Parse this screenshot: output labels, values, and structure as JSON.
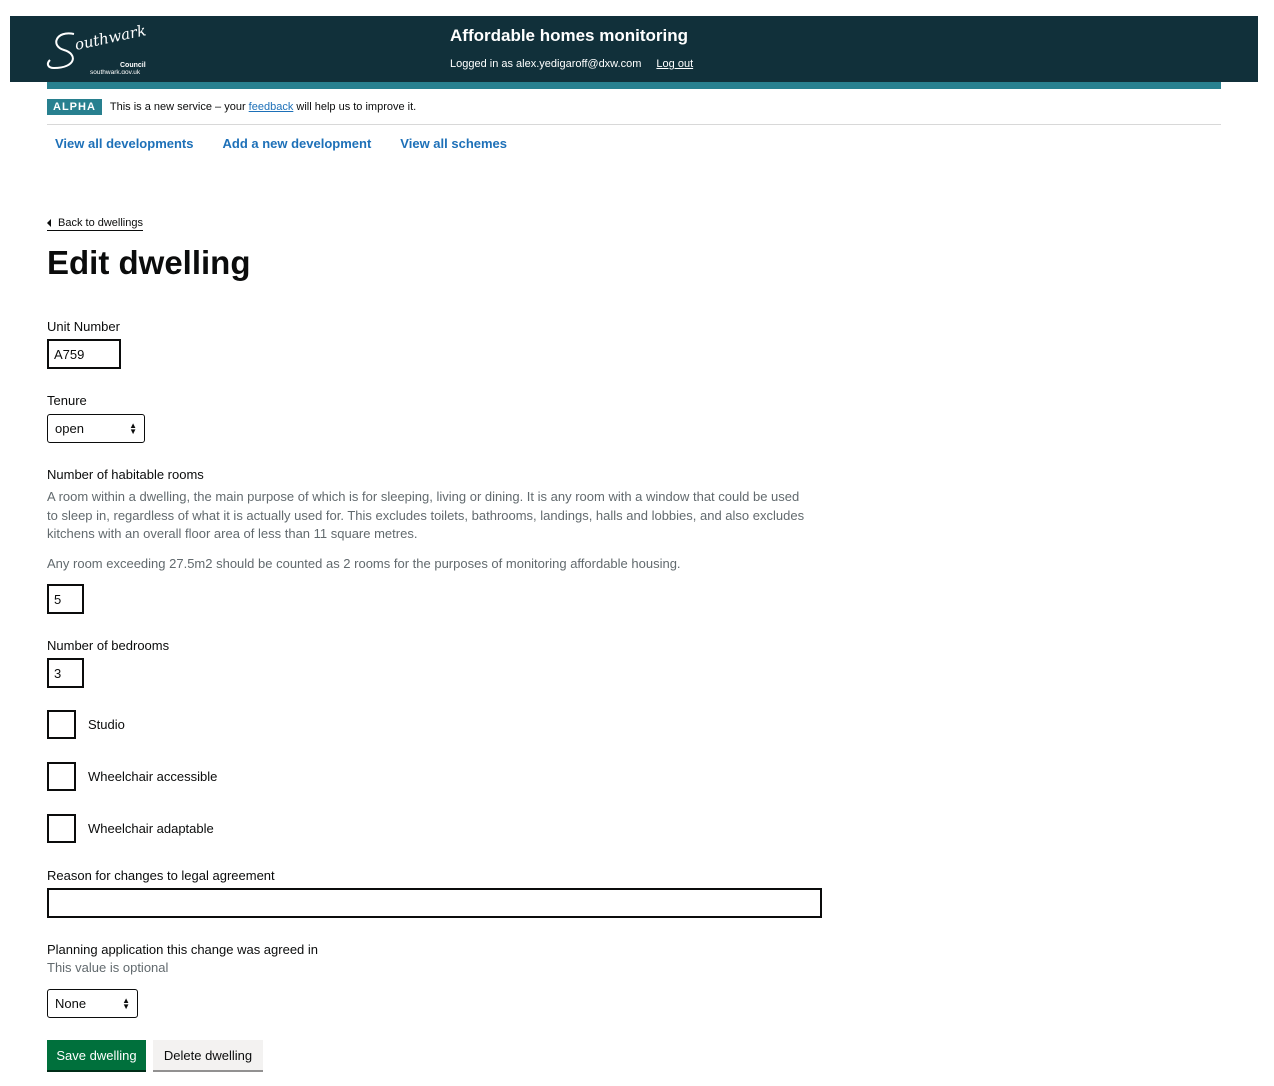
{
  "header": {
    "logo_text": "Southwark",
    "logo_council": "Council",
    "logo_url_text": "southwark.gov.uk",
    "title": "Affordable homes monitoring",
    "logged_in_text": "Logged in as alex.yedigaroff@dxw.com",
    "logout_label": "Log out"
  },
  "phase_banner": {
    "tag": "ALPHA",
    "text_before": "This is a new service – your",
    "link": "feedback",
    "text_after": "will help us to improve it."
  },
  "nav": [
    {
      "label": "View all developments"
    },
    {
      "label": "Add a new development"
    },
    {
      "label": "View all schemes"
    }
  ],
  "back_link": "Back to dwellings",
  "page_title": "Edit dwelling",
  "form": {
    "unit_number": {
      "label": "Unit Number",
      "value": "A759"
    },
    "tenure": {
      "label": "Tenure",
      "value": "open"
    },
    "habitable_rooms": {
      "label": "Number of habitable rooms",
      "hint1": "A room within a dwelling, the main purpose of which is for sleeping, living or dining. It is any room with a window that could be used to sleep in, regardless of what it is actually used for. This excludes toilets, bathrooms, landings, halls and lobbies, and also excludes kitchens with an overall floor area of less than 11 square metres.",
      "hint2": "Any room exceeding 27.5m2 should be counted as 2 rooms for the purposes of monitoring affordable housing.",
      "value": "5"
    },
    "bedrooms": {
      "label": "Number of bedrooms",
      "value": "3"
    },
    "checkboxes": [
      {
        "label": "Studio",
        "checked": false
      },
      {
        "label": "Wheelchair accessible",
        "checked": false
      },
      {
        "label": "Wheelchair adaptable",
        "checked": false
      }
    ],
    "reason": {
      "label": "Reason for changes to legal agreement",
      "value": ""
    },
    "planning_application": {
      "label": "Planning application this change was agreed in",
      "hint": "This value is optional",
      "value": "None"
    }
  },
  "buttons": {
    "save": "Save dwelling",
    "delete": "Delete dwelling"
  },
  "colors": {
    "header_bg": "#11303a",
    "teal": "#28808f",
    "link": "#1d70b8",
    "save_green": "#00703c"
  }
}
